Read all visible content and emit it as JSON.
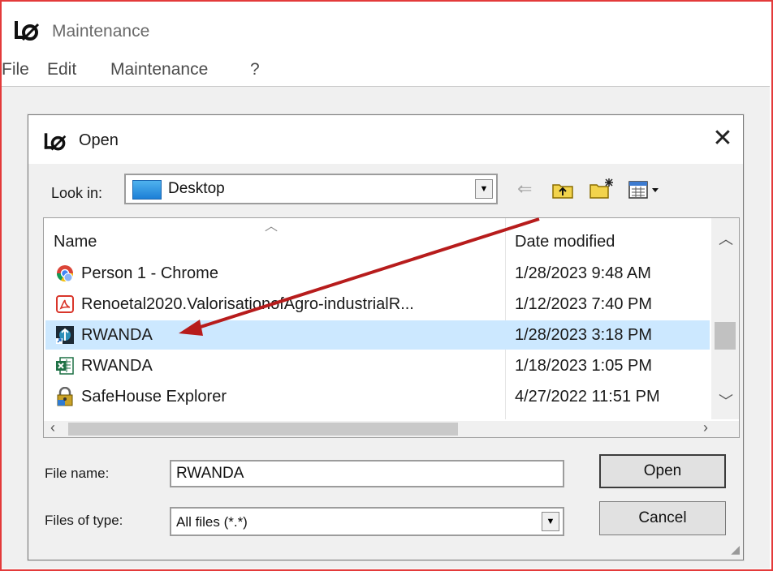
{
  "app": {
    "title": "Maintenance",
    "menu": [
      "File",
      "Edit",
      "Maintenance",
      "?"
    ]
  },
  "dialog": {
    "title": "Open",
    "close_label": "✕",
    "look_in_label": "Look in:",
    "look_in_value": "Desktop",
    "columns": {
      "name": "Name",
      "date": "Date modified"
    },
    "files": [
      {
        "name": "Person 1 - Chrome",
        "date": "1/28/2023 9:48 AM",
        "icon": "chrome-icon",
        "selected": false
      },
      {
        "name": "Renoetal2020.ValorisationofAgro-industrialR...",
        "date": "1/12/2023 7:40 PM",
        "icon": "pdf-icon",
        "selected": false
      },
      {
        "name": "RWANDA",
        "date": "1/28/2023 3:18 PM",
        "icon": "app-shortcut-icon",
        "selected": true
      },
      {
        "name": "RWANDA",
        "date": "1/18/2023 1:05 PM",
        "icon": "excel-icon",
        "selected": false
      },
      {
        "name": "SafeHouse Explorer",
        "date": "4/27/2022 11:51 PM",
        "icon": "safehouse-icon",
        "selected": false
      }
    ],
    "file_name_label": "File name:",
    "file_name_value": "RWANDA",
    "files_of_type_label": "Files of type:",
    "files_of_type_value": "All files (*.*)",
    "open_button": "Open",
    "cancel_button": "Cancel"
  },
  "colors": {
    "selection": "#cce8ff",
    "annotation_arrow": "#b71c1c",
    "outer_border": "#e33a3a"
  }
}
